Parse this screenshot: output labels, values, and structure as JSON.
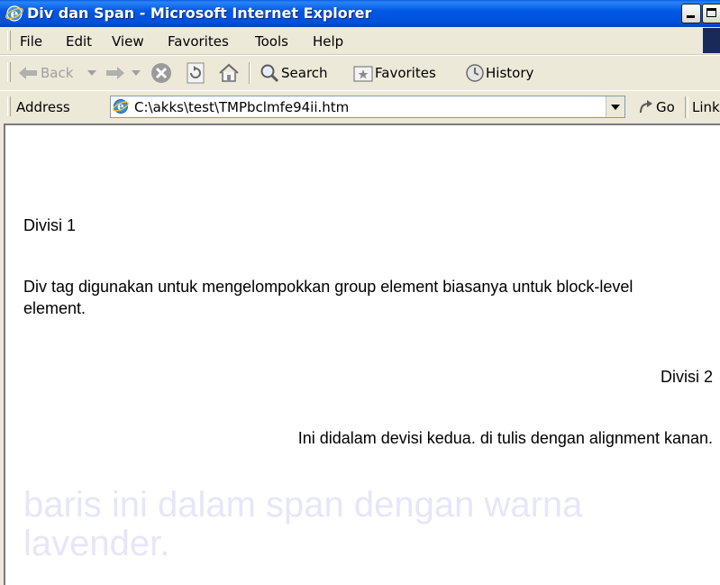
{
  "window": {
    "title": "Div dan Span - Microsoft Internet Explorer",
    "colors": {
      "titlebar": "#0058e6",
      "chrome": "#ece9d8",
      "lavender": "#e6e6fa"
    }
  },
  "menu": {
    "items": [
      "File",
      "Edit",
      "View",
      "Favorites",
      "Tools",
      "Help"
    ]
  },
  "toolbar": {
    "back": "Back",
    "search": "Search",
    "favorites": "Favorites",
    "history": "History"
  },
  "address": {
    "label": "Address",
    "value": "C:\\akks\\test\\TMPbclmfe94ii.htm",
    "go": "Go",
    "links": "Links"
  },
  "page": {
    "div1_label": "Divisi 1",
    "div1_text": "Div tag digunakan untuk mengelompokkan group element biasanya untuk block-level element.",
    "div2_label": "Divisi 2",
    "div2_text": "Ini didalam devisi kedua. di tulis dengan alignment kanan.",
    "span_text": "baris ini dalam span dengan warna lavender."
  }
}
